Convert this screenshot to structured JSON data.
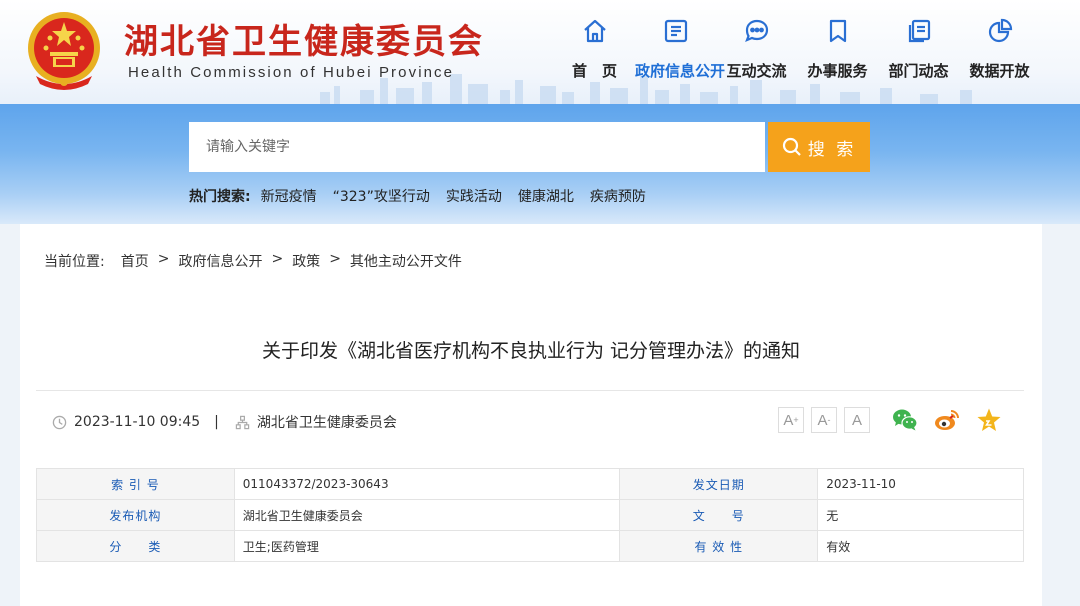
{
  "header": {
    "title": "湖北省卫生健康委员会",
    "subtitle": "Health Commission of Hubei Province"
  },
  "nav": [
    {
      "label": "首　页",
      "icon": "home-icon",
      "active": false
    },
    {
      "label": "政府信息公开",
      "icon": "document-list-icon",
      "active": true
    },
    {
      "label": "互动交流",
      "icon": "chat-bubble-icon",
      "active": false
    },
    {
      "label": "办事服务",
      "icon": "bookmark-icon",
      "active": false
    },
    {
      "label": "部门动态",
      "icon": "documents-icon",
      "active": false
    },
    {
      "label": "数据开放",
      "icon": "pie-chart-icon",
      "active": false
    }
  ],
  "search": {
    "placeholder": "请输入关键字",
    "button_label": "搜 索",
    "hot_title": "热门搜索:",
    "hot_items": [
      "新冠疫情",
      "“323”攻坚行动",
      "实践活动",
      "健康湖北",
      "疾病预防"
    ]
  },
  "breadcrumb": {
    "lead": "当前位置:",
    "items": [
      "首页",
      "政府信息公开",
      "政策",
      "其他主动公开文件"
    ],
    "separator": ">"
  },
  "article": {
    "title": "关于印发《湖北省医疗机构不良执业行为 记分管理办法》的通知",
    "datetime": "2023-11-10 09:45",
    "pipe": "|",
    "source": "湖北省卫生健康委员会"
  },
  "font_size": {
    "larger": "A",
    "smaller": "A",
    "normal": "A",
    "plus": "+",
    "minus": "-"
  },
  "info_table": {
    "rows": [
      {
        "label1": "索 引 号",
        "value1": "011043372/2023-30643",
        "label2": "发文日期",
        "value2": "2023-11-10"
      },
      {
        "label1": "发布机构",
        "value1": "湖北省卫生健康委员会",
        "label2": "文　　号",
        "value2": "无"
      },
      {
        "label1": "分　　类",
        "value1": "卫生;医药管理",
        "label2": "有 效 性",
        "value2": "有效"
      }
    ]
  },
  "colors": {
    "brand_red": "#c8261c",
    "nav_active": "#1f6fd6",
    "icon_blue": "#2a6fd3",
    "search_orange": "#f5a21b",
    "wechat_green": "#3fb34f",
    "weibo_orange": "#f0891e",
    "favorite_yellow": "#f3b51b"
  }
}
